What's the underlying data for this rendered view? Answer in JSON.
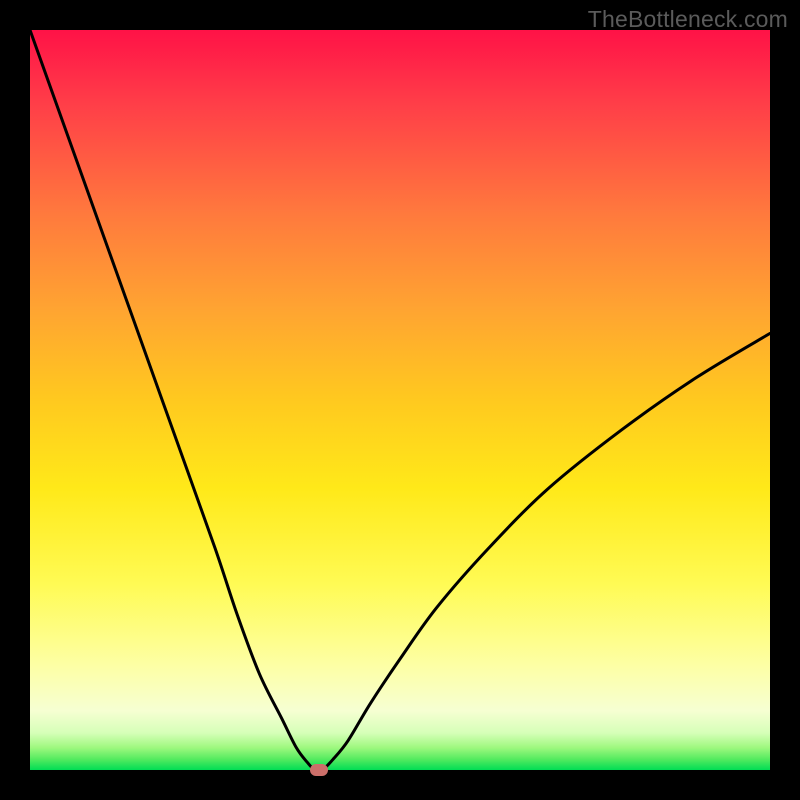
{
  "watermark": "TheBottleneck.com",
  "chart_data": {
    "type": "line",
    "title": "",
    "xlabel": "",
    "ylabel": "",
    "xlim": [
      0,
      100
    ],
    "ylim": [
      0,
      100
    ],
    "series": [
      {
        "name": "bottleneck-curve",
        "x": [
          0,
          5,
          10,
          15,
          20,
          25,
          28,
          31,
          34,
          36,
          37.5,
          38.5,
          39.5,
          41,
          43,
          46,
          50,
          55,
          62,
          70,
          80,
          90,
          100
        ],
        "values": [
          100,
          86,
          72,
          58,
          44,
          30,
          21,
          13,
          7,
          3,
          1,
          0,
          0,
          1.5,
          4,
          9,
          15,
          22,
          30,
          38,
          46,
          53,
          59
        ]
      }
    ],
    "marker": {
      "x": 39,
      "y": 0,
      "color": "#cc6f6a"
    },
    "background_gradient": {
      "stops": [
        {
          "pos": 0,
          "color": "#ff1247"
        },
        {
          "pos": 0.25,
          "color": "#ff7a3d"
        },
        {
          "pos": 0.5,
          "color": "#ffc91f"
        },
        {
          "pos": 0.75,
          "color": "#fffb55"
        },
        {
          "pos": 0.92,
          "color": "#f6ffd2"
        },
        {
          "pos": 1.0,
          "color": "#00dd55"
        }
      ]
    }
  }
}
